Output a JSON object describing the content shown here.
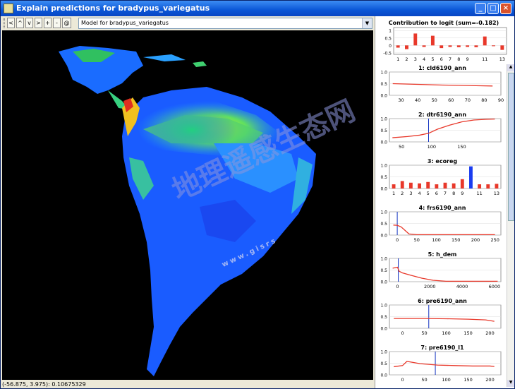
{
  "window": {
    "title": "Explain predictions for bradypus_variegatus"
  },
  "toolbar": {
    "buttons": [
      "<",
      "^",
      "v",
      ">",
      "+",
      "-",
      "@"
    ],
    "model_select": "Model for bradypus_variegatus"
  },
  "status_text": "(-56.875, 3.975): 0.10675329",
  "watermark": {
    "main": "地理遥感生态网",
    "sub": "www.gisrs"
  },
  "contribution": {
    "title": "Contribution to logit (sum=-0.182)",
    "categories": [
      "1",
      "2",
      "3",
      "4",
      "5",
      "6",
      "7",
      "8",
      "9",
      "10",
      "11",
      "12",
      "13"
    ],
    "xlabels": [
      "1",
      "2",
      "3",
      "4",
      "5",
      "6",
      "7",
      "8",
      "9",
      "11",
      "13"
    ],
    "values": [
      -0.15,
      -0.25,
      0.8,
      -0.1,
      0.65,
      -0.18,
      -0.1,
      -0.12,
      -0.1,
      -0.12,
      0.6,
      -0.05,
      -0.3
    ],
    "yticks": [
      "1",
      "0.5",
      "0",
      "-0.5"
    ],
    "ylim": [
      -0.6,
      1.2
    ]
  },
  "panels": [
    {
      "title": "1: cld6190_ann",
      "type": "line",
      "xlim": [
        23,
        90
      ],
      "xticks": [
        "30",
        "40",
        "50",
        "60",
        "70",
        "80",
        "90"
      ],
      "x": [
        25,
        40,
        55,
        70,
        85
      ],
      "y": [
        0.5,
        0.47,
        0.44,
        0.42,
        0.4
      ],
      "marker": null
    },
    {
      "title": "2: dtr6190_ann",
      "type": "line",
      "xlim": [
        30,
        215
      ],
      "xticks": [
        "50",
        "100",
        "150"
      ],
      "x": [
        35,
        60,
        80,
        95,
        110,
        130,
        150,
        170,
        190,
        205
      ],
      "y": [
        0.18,
        0.23,
        0.29,
        0.37,
        0.55,
        0.72,
        0.86,
        0.94,
        0.97,
        0.98
      ],
      "marker": 95
    },
    {
      "title": "3: ecoreg",
      "type": "bar",
      "categories": [
        "1",
        "2",
        "3",
        "4",
        "5",
        "6",
        "7",
        "8",
        "9",
        "10",
        "11",
        "12",
        "13"
      ],
      "xlabels": [
        "1",
        "2",
        "3",
        "4",
        "5",
        "6",
        "7",
        "8",
        "9",
        "11",
        "13"
      ],
      "values": [
        0.18,
        0.32,
        0.25,
        0.22,
        0.28,
        0.18,
        0.25,
        0.22,
        0.4,
        0.95,
        0.18,
        0.18,
        0.2
      ],
      "highlight": "10"
    },
    {
      "title": "4: frs6190_ann",
      "type": "line",
      "xlim": [
        -20,
        265
      ],
      "xticks": [
        "0",
        "50",
        "100",
        "150",
        "200",
        "250"
      ],
      "x": [
        -10,
        0,
        10,
        20,
        30,
        50,
        100,
        200,
        250
      ],
      "y": [
        0.43,
        0.42,
        0.35,
        0.2,
        0.05,
        0.02,
        0.02,
        0.02,
        0.02
      ],
      "marker": 0
    },
    {
      "title": "5: h_dem",
      "type": "line",
      "xlim": [
        -500,
        6400
      ],
      "xticks": [
        "0",
        "2000",
        "4000",
        "6000"
      ],
      "x": [
        -300,
        0,
        100,
        300,
        800,
        1500,
        2200,
        3000,
        6200
      ],
      "y": [
        0.58,
        0.62,
        0.45,
        0.38,
        0.28,
        0.15,
        0.06,
        0.02,
        0.02
      ],
      "marker": 50
    },
    {
      "title": "6: pre6190_ann",
      "type": "line",
      "xlim": [
        -30,
        225
      ],
      "xticks": [
        "0",
        "50",
        "100",
        "150",
        "200"
      ],
      "x": [
        -20,
        0,
        50,
        100,
        150,
        190,
        210
      ],
      "y": [
        0.42,
        0.42,
        0.42,
        0.41,
        0.39,
        0.36,
        0.3
      ],
      "marker": 60
    },
    {
      "title": "7: pre6190_l1",
      "type": "line",
      "xlim": [
        -30,
        225
      ],
      "xticks": [
        "0",
        "50",
        "100",
        "150",
        "200"
      ],
      "x": [
        -20,
        0,
        10,
        40,
        80,
        120,
        160,
        200,
        210
      ],
      "y": [
        0.35,
        0.4,
        0.58,
        0.48,
        0.42,
        0.4,
        0.38,
        0.38,
        0.36
      ],
      "marker": 75
    }
  ],
  "panel_yticks": [
    "1.0",
    "0.5",
    "0.0"
  ]
}
